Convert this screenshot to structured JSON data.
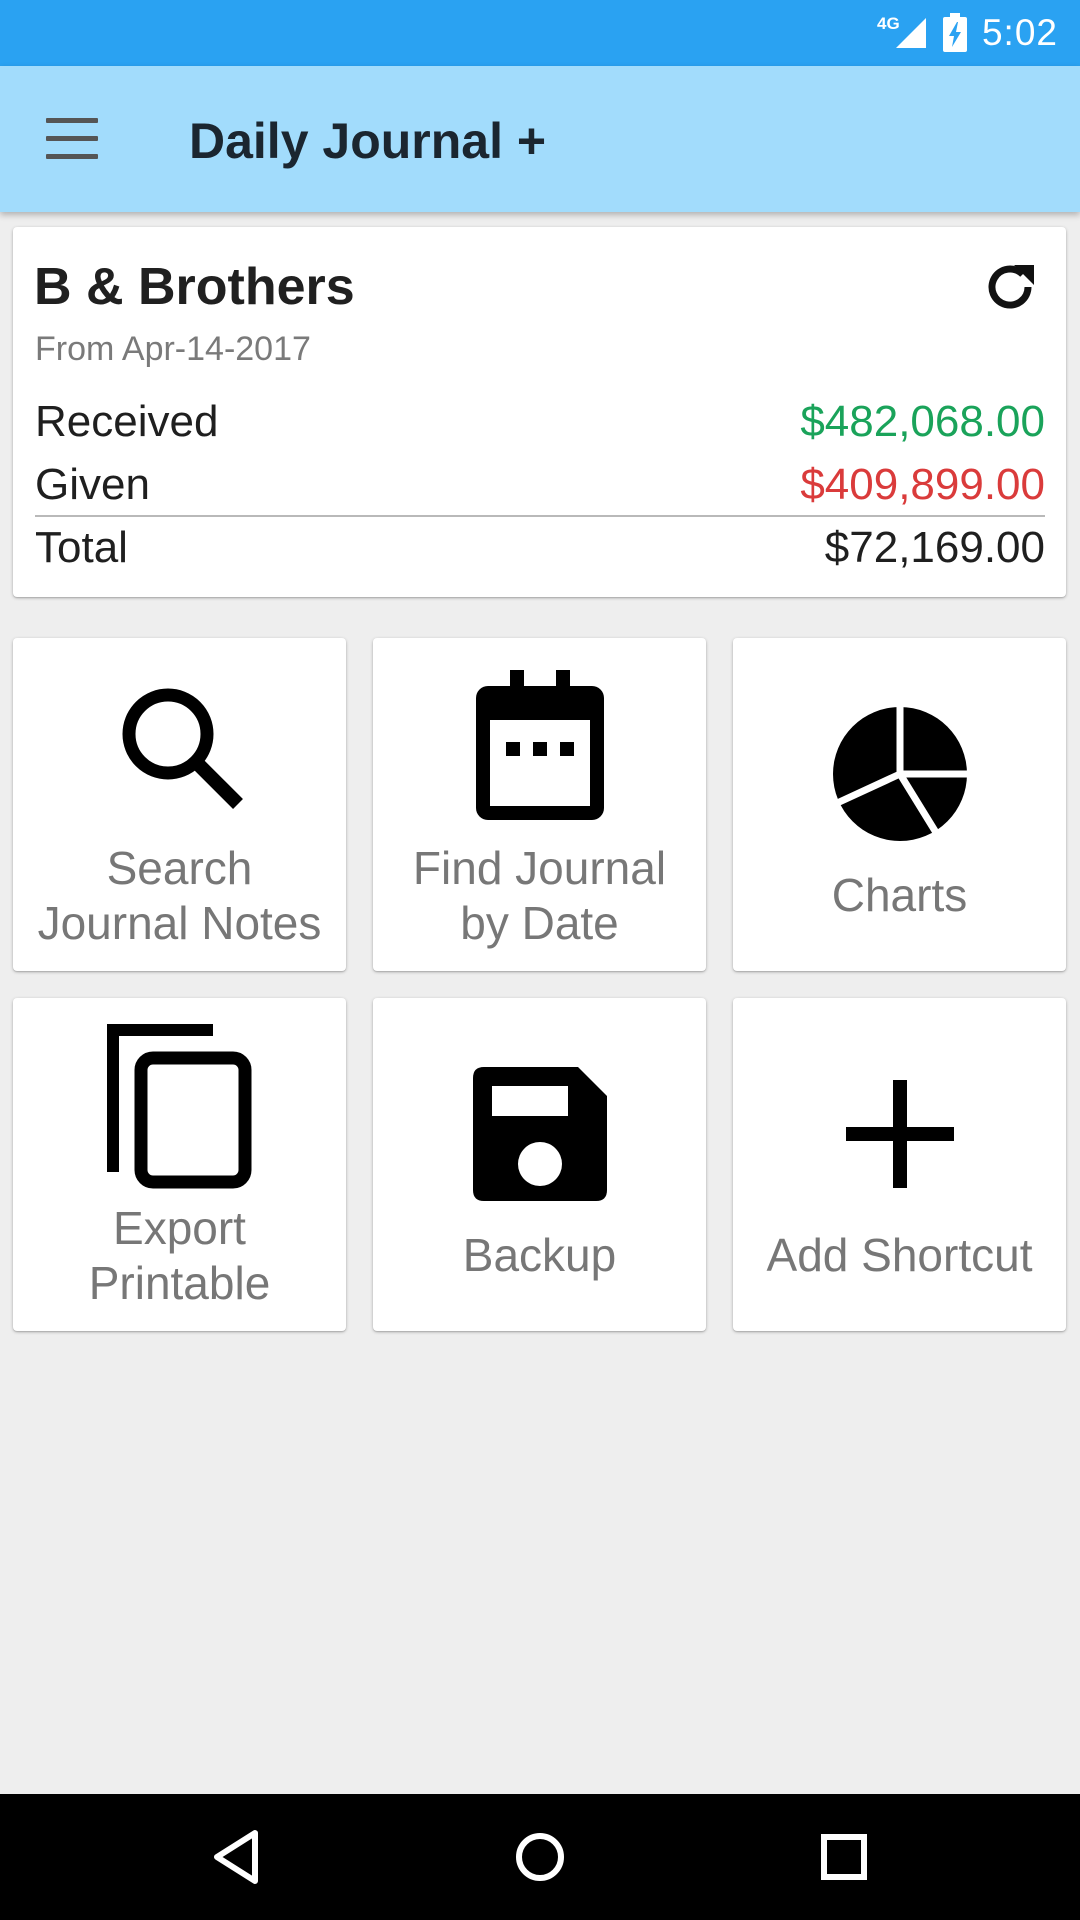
{
  "status_bar": {
    "network": "4G",
    "time": "5:02"
  },
  "app_bar": {
    "title": "Daily Journal +",
    "menu_icon": "hamburger-menu-icon"
  },
  "summary": {
    "company": "B & Brothers",
    "since": "From Apr-14-2017",
    "refresh_icon": "refresh-icon",
    "rows": {
      "received": {
        "label": "Received",
        "value": "$482,068.00",
        "color": "#1aa35a"
      },
      "given": {
        "label": "Given",
        "value": "$409,899.00",
        "color": "#da3b3b"
      },
      "total": {
        "label": "Total",
        "value": "$72,169.00"
      }
    }
  },
  "tiles": {
    "search": {
      "line1": "Search",
      "line2": "Journal Notes",
      "icon": "search-icon"
    },
    "find_date": {
      "line1": "Find Journal",
      "line2": "by Date",
      "icon": "calendar-icon"
    },
    "charts": {
      "label": "Charts",
      "icon": "pie-chart-icon"
    },
    "export": {
      "line1": "Export",
      "line2": "Printable",
      "icon": "copy-icon"
    },
    "backup": {
      "label": "Backup",
      "icon": "save-icon"
    },
    "add_shortcut": {
      "label": "Add Shortcut",
      "icon": "plus-icon"
    }
  },
  "nav_bar": {
    "back": "back-icon",
    "home": "home-icon",
    "recents": "recents-icon"
  },
  "colors": {
    "status_bar": "#2aa2f2",
    "app_bar": "#a2dcfc",
    "background": "#eeeeee",
    "received": "#1aa35a",
    "given": "#da3b3b"
  }
}
